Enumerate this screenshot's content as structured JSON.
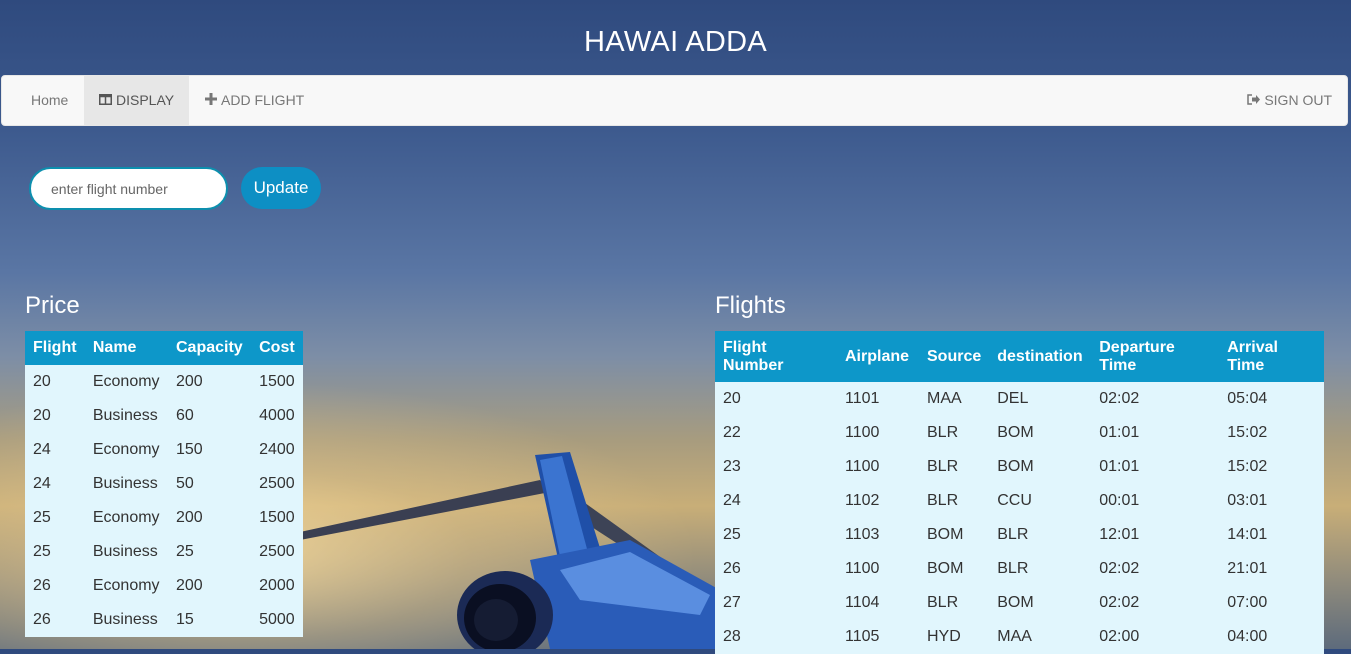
{
  "app": {
    "title": "HAWAI ADDA"
  },
  "nav": {
    "home": "Home",
    "display": "DISPLAY",
    "add_flight": "ADD FLIGHT",
    "sign_out": "SIGN OUT"
  },
  "search": {
    "placeholder": "enter flight number",
    "value": "",
    "button": "Update"
  },
  "price": {
    "title": "Price",
    "columns": [
      "Flight",
      "Name",
      "Capacity",
      "Cost"
    ],
    "rows": [
      [
        "20",
        "Economy",
        "200",
        "1500"
      ],
      [
        "20",
        "Business",
        "60",
        "4000"
      ],
      [
        "24",
        "Economy",
        "150",
        "2400"
      ],
      [
        "24",
        "Business",
        "50",
        "2500"
      ],
      [
        "25",
        "Economy",
        "200",
        "1500"
      ],
      [
        "25",
        "Business",
        "25",
        "2500"
      ],
      [
        "26",
        "Economy",
        "200",
        "2000"
      ],
      [
        "26",
        "Business",
        "15",
        "5000"
      ]
    ]
  },
  "flights": {
    "title": "Flights",
    "columns": [
      "Flight Number",
      "Airplane",
      "Source",
      "destination",
      "Departure Time",
      "Arrival Time"
    ],
    "rows": [
      [
        "20",
        "1101",
        "MAA",
        "DEL",
        "02:02",
        "05:04"
      ],
      [
        "22",
        "1100",
        "BLR",
        "BOM",
        "01:01",
        "15:02"
      ],
      [
        "23",
        "1100",
        "BLR",
        "BOM",
        "01:01",
        "15:02"
      ],
      [
        "24",
        "1102",
        "BLR",
        "CCU",
        "00:01",
        "03:01"
      ],
      [
        "25",
        "1103",
        "BOM",
        "BLR",
        "12:01",
        "14:01"
      ],
      [
        "26",
        "1100",
        "BOM",
        "BLR",
        "02:02",
        "21:01"
      ],
      [
        "27",
        "1104",
        "BLR",
        "BOM",
        "02:02",
        "07:00"
      ],
      [
        "28",
        "1105",
        "HYD",
        "MAA",
        "02:00",
        "04:00"
      ]
    ]
  },
  "colors": {
    "accent": "#0d97c9",
    "row_bg": "#e1f6fd",
    "navbar_bg": "#f8f8f8"
  },
  "icons": {
    "display": "columns-icon",
    "add_flight": "plus-icon",
    "sign_out": "sign-out-icon"
  }
}
